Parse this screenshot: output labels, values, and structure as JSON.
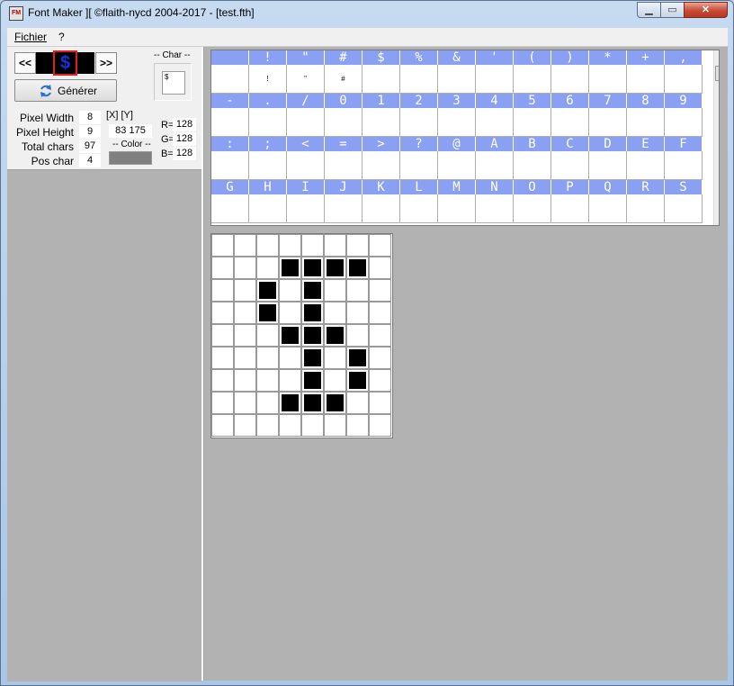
{
  "window": {
    "title": "Font Maker ][ ©flaith-nycd 2004-2017 - [test.fth]",
    "app_icon": "fm-app-icon",
    "controls": {
      "minimize": "▁",
      "maximize": "▭",
      "close": "✕"
    }
  },
  "menu": {
    "items": [
      "Fichier",
      "?"
    ]
  },
  "navigator": {
    "prev_label": "<<",
    "next_label": ">>",
    "current_char": "$"
  },
  "generate": {
    "label": "Générer",
    "icon": "refresh-icon"
  },
  "char_group": {
    "label": "-- Char --",
    "preview": "$"
  },
  "pixel_info": {
    "width_label": "Pixel Width",
    "width_value": "8",
    "height_label": "Pixel Height",
    "height_value": "9",
    "total_label": "Total chars",
    "total_value": "97",
    "pos_label": "Pos char",
    "pos_value": "4"
  },
  "xy": {
    "label": "[X] [Y]",
    "value": "83  175"
  },
  "color": {
    "label": "-- Color --",
    "swatch": "#808080",
    "r_label": "R=",
    "r_value": "128",
    "g_label": "G=",
    "g_value": "128",
    "b_label": "B=",
    "b_value": "128"
  },
  "charmap": {
    "rows": [
      {
        "headers": [
          "",
          "!",
          "\"",
          "#",
          "$",
          "%",
          "&",
          "'",
          "(",
          ")",
          "*",
          "+",
          ","
        ],
        "previews": [
          "",
          "!",
          "\"",
          "#",
          "",
          "",
          "",
          "",
          "",
          "",
          "",
          "",
          ""
        ]
      },
      {
        "headers": [
          "-",
          ".",
          "/",
          "0",
          "1",
          "2",
          "3",
          "4",
          "5",
          "6",
          "7",
          "8",
          "9"
        ],
        "previews": [
          "",
          "",
          "",
          "",
          "",
          "",
          "",
          "",
          "",
          "",
          "",
          "",
          ""
        ]
      },
      {
        "headers": [
          ":",
          ";",
          "<",
          "=",
          ">",
          "?",
          "@",
          "A",
          "B",
          "C",
          "D",
          "E",
          "F"
        ],
        "previews": [
          "",
          "",
          "",
          "",
          "",
          "",
          "",
          "",
          "",
          "",
          "",
          "",
          ""
        ]
      },
      {
        "headers": [
          "G",
          "H",
          "I",
          "J",
          "K",
          "L",
          "M",
          "N",
          "O",
          "P",
          "Q",
          "R",
          "S"
        ],
        "previews": [
          "",
          "",
          "",
          "",
          "",
          "",
          "",
          "",
          "",
          "",
          "",
          "",
          ""
        ]
      }
    ],
    "header_color": "#8aa0f2"
  },
  "editor": {
    "cols": 8,
    "rows": 9,
    "pixels": [
      [
        0,
        0,
        0,
        0,
        0,
        0,
        0,
        0
      ],
      [
        0,
        0,
        0,
        1,
        1,
        1,
        1,
        0
      ],
      [
        0,
        0,
        1,
        0,
        1,
        0,
        0,
        0
      ],
      [
        0,
        0,
        1,
        0,
        1,
        0,
        0,
        0
      ],
      [
        0,
        0,
        0,
        1,
        1,
        1,
        0,
        0
      ],
      [
        0,
        0,
        0,
        0,
        1,
        0,
        1,
        0
      ],
      [
        0,
        0,
        0,
        0,
        1,
        0,
        1,
        0
      ],
      [
        0,
        0,
        0,
        1,
        1,
        1,
        0,
        0
      ],
      [
        0,
        0,
        0,
        0,
        0,
        0,
        0,
        0
      ]
    ]
  }
}
